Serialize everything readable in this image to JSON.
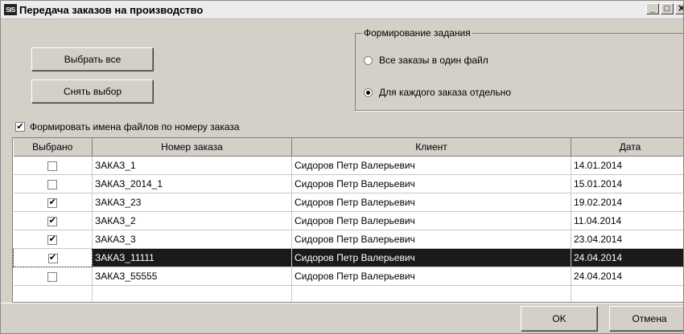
{
  "window": {
    "icon_text": "SIS",
    "title": "Передача заказов на производство",
    "min_glyph": "_",
    "max_glyph": "□",
    "close_glyph": "✕"
  },
  "buttons": {
    "select_all": "Выбрать все",
    "deselect": "Снять выбор",
    "ok": "OK",
    "cancel": "Отмена"
  },
  "task_group": {
    "title": "Формирование задания",
    "options": [
      {
        "label": "Все заказы в один файл",
        "selected": false
      },
      {
        "label": "Для каждого заказа отдельно",
        "selected": true
      }
    ]
  },
  "filenames_checkbox": {
    "label": "Формировать имена файлов по номеру заказа",
    "checked": true,
    "glyph": "✔"
  },
  "table": {
    "headers": [
      "Выбрано",
      "Номер заказа",
      "Клиент",
      "Дата"
    ],
    "rows": [
      {
        "checked": false,
        "order": "ЗАКАЗ_1",
        "client": "Сидоров Петр Валерьевич",
        "date": "14.01.2014"
      },
      {
        "checked": false,
        "order": "ЗАКАЗ_2014_1",
        "client": "Сидоров Петр Валерьевич",
        "date": "15.01.2014"
      },
      {
        "checked": true,
        "order": "ЗАКАЗ_23",
        "client": "Сидоров Петр Валерьевич",
        "date": "19.02.2014"
      },
      {
        "checked": true,
        "order": "ЗАКАЗ_2",
        "client": "Сидоров Петр Валерьевич",
        "date": "11.04.2014"
      },
      {
        "checked": true,
        "order": "ЗАКАЗ_3",
        "client": "Сидоров Петр Валерьевич",
        "date": "23.04.2014"
      },
      {
        "checked": true,
        "order": "ЗАКАЗ_11111",
        "client": "Сидоров Петр Валерьевич",
        "date": "24.04.2014",
        "selected": true
      },
      {
        "checked": false,
        "order": "ЗАКАЗ_55555",
        "client": "Сидоров Петр Валерьевич",
        "date": "24.04.2014"
      }
    ],
    "check_glyph": "✔"
  },
  "colors": {
    "face": "#d4d0c8",
    "selection": "#1a1a1a"
  }
}
